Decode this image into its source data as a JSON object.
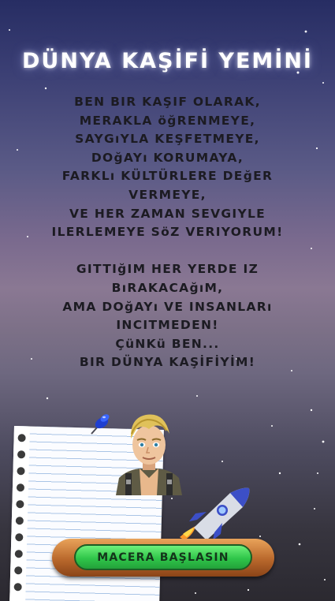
{
  "title": "DÜNYA KAŞİFİ YEMİNİ",
  "oath_lines": [
    "BEN BIR KAŞIF OLARAK,",
    "MERAKLA öğRENMEYE,",
    "SAYGıYLA KEŞFETMEYE,",
    "DOğAYı KORUMAYA,",
    "FARKLı KÜLTÜRLERE DEğER",
    "VERMEYE,",
    "VE HER ZAMAN SEVGIYLE",
    "ILERLEMEYE SöZ VERIYORUM!",
    "",
    "GITTIğIM HER YERDE IZ",
    "BıRAKACAğıM,",
    "AMA DOğAYı VE INSANLARı",
    "INCITMEDEN!",
    "ÇüNKü BEN...",
    "BIR DÜNYA KAŞİFİYİM!"
  ],
  "start_button": "MACERA BAŞLASIN",
  "colors": {
    "title": "#ffffff",
    "oath_text": "#1c1b22",
    "button_fill": "#36c94d",
    "button_frame": "#c2732f"
  },
  "icons": [
    "push-pin-icon",
    "explorer-character",
    "rocket-icon",
    "notebook-paper"
  ]
}
